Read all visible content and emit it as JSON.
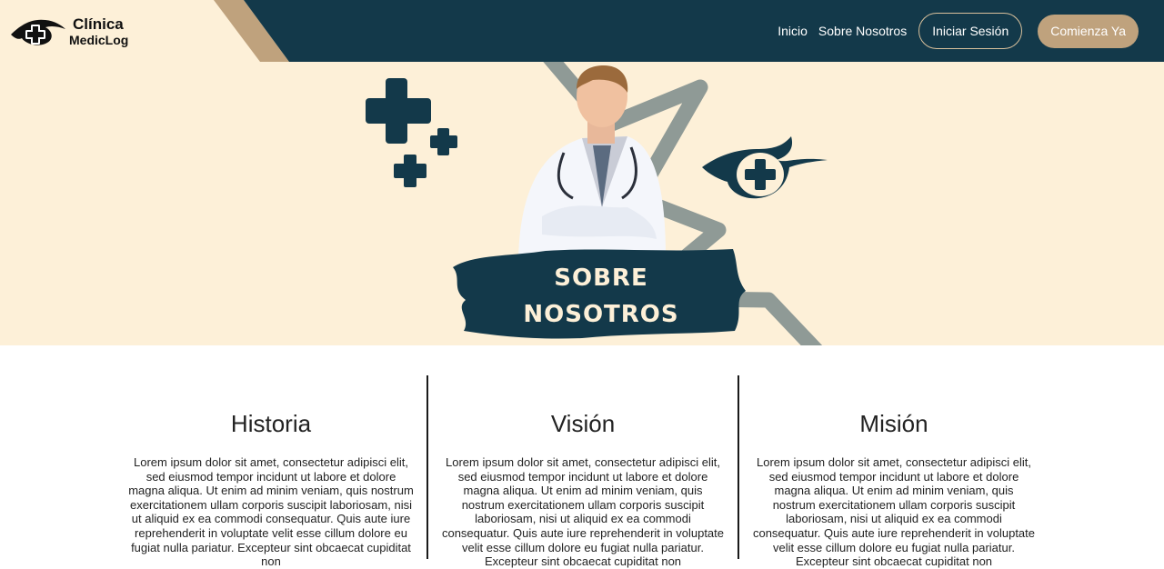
{
  "brand": {
    "name_line1": "Clínica",
    "name_line2": "MedicLog"
  },
  "nav": {
    "links": [
      "Inicio",
      "Sobre Nosotros"
    ],
    "login_button": "Iniciar Sesión",
    "cta_button": "Comienza Ya"
  },
  "hero": {
    "title_line1": "SOBRE",
    "title_line2": "NOSOTROS",
    "image": "doctor-photo",
    "icons": [
      "medical-cross-icon",
      "medical-logo-icon"
    ]
  },
  "sections": [
    {
      "title": "Historia",
      "text": "Lorem ipsum dolor sit amet, consectetur adipisci elit, sed eiusmod tempor incidunt ut labore et dolore magna aliqua. Ut enim ad minim veniam, quis nostrum exercitationem ullam corporis suscipit laboriosam, nisi ut aliquid ex ea commodi consequatur. Quis aute iure reprehenderit in voluptate velit esse cillum dolore eu fugiat nulla pariatur. Excepteur sint obcaecat cupiditat non"
    },
    {
      "title": "Visión",
      "text": "Lorem ipsum dolor sit amet, consectetur adipisci elit, sed eiusmod tempor incidunt ut labore et dolore magna aliqua. Ut enim ad minim veniam, quis nostrum exercitationem ullam corporis suscipit laboriosam, nisi ut aliquid ex ea commodi consequatur. Quis aute iure reprehenderit in voluptate velit esse cillum dolore eu fugiat nulla pariatur. Excepteur sint obcaecat cupiditat non"
    },
    {
      "title": "Misión",
      "text": "Lorem ipsum dolor sit amet, consectetur adipisci elit, sed eiusmod tempor incidunt ut labore et dolore magna aliqua. Ut enim ad minim veniam, quis nostrum exercitationem ullam corporis suscipit laboriosam, nisi ut aliquid ex ea commodi consequatur. Quis aute iure reprehenderit in voluptate velit esse cillum dolore eu fugiat nulla pariatur. Excepteur sint obcaecat cupiditat non"
    }
  ],
  "colors": {
    "navy": "#13394a",
    "cream": "#fdf0d8",
    "tan": "#bfa27d",
    "gray": "#8f9a96"
  }
}
